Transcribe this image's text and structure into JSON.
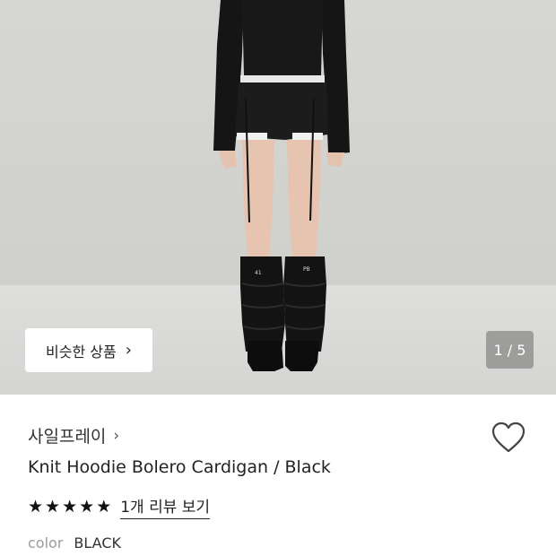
{
  "gallery": {
    "similar_button_label": "비슷한 상품",
    "similar_button_chevron": "›",
    "counter": "1 / 5",
    "shin_tag_left": "41",
    "shin_tag_right": "PB"
  },
  "product": {
    "brand": "사일프레이",
    "brand_chevron": "›",
    "title": "Knit Hoodie Bolero Cardigan / Black",
    "rating_stars": 5,
    "review_link": "1개 리뷰 보기",
    "option_label": "color",
    "option_value": "BLACK"
  },
  "colors": {
    "background": "#ffffff",
    "text": "#222222",
    "muted": "#9a9a9a"
  },
  "icons": {
    "wishlist": "heart-outline-icon",
    "star": "star-icon",
    "chevron": "chevron-right-icon"
  }
}
